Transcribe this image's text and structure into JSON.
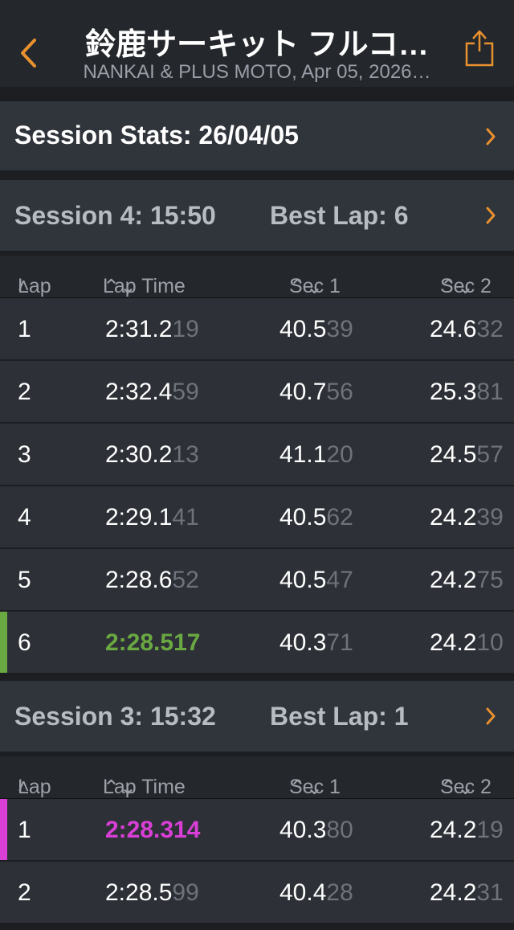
{
  "nav": {
    "title": "鈴鹿サーキット フルコ…",
    "subtitle": "NANKAI & PLUS MOTO, Apr 05, 2026…"
  },
  "stats_row": {
    "label": "Session Stats: 26/04/05"
  },
  "colors": {
    "accent": "#e8912e",
    "best_green": "#6aa842",
    "best_purple": "#d93fd6",
    "bg": "#1c1e22",
    "row": "#2d3036"
  },
  "table_header": {
    "lap": "Lap",
    "lap_time": "Lap Time",
    "sec1": "Sec 1",
    "sec2": "Sec 2",
    "lap_sort_icon": "chevron-up-icon",
    "sort_icon": "sort-updown-icon"
  },
  "sessions": [
    {
      "label": "Session 4:  15:50",
      "best": "Best Lap: 6",
      "laps": [
        {
          "lap": "1",
          "time_a": "2:31.2",
          "time_b": "19",
          "s1_a": "40.5",
          "s1_b": "39",
          "s2_a": "24.6",
          "s2_b": "32"
        },
        {
          "lap": "2",
          "time_a": "2:32.4",
          "time_b": "59",
          "s1_a": "40.7",
          "s1_b": "56",
          "s2_a": "25.3",
          "s2_b": "81"
        },
        {
          "lap": "3",
          "time_a": "2:30.2",
          "time_b": "13",
          "s1_a": "41.1",
          "s1_b": "20",
          "s2_a": "24.5",
          "s2_b": "57"
        },
        {
          "lap": "4",
          "time_a": "2:29.1",
          "time_b": "41",
          "s1_a": "40.5",
          "s1_b": "62",
          "s2_a": "24.2",
          "s2_b": "39"
        },
        {
          "lap": "5",
          "time_a": "2:28.6",
          "time_b": "52",
          "s1_a": "40.5",
          "s1_b": "47",
          "s2_a": "24.2",
          "s2_b": "75"
        },
        {
          "lap": "6",
          "time_a": "2:28.517",
          "time_b": "",
          "s1_a": "40.3",
          "s1_b": "71",
          "s2_a": "24.2",
          "s2_b": "10"
        }
      ]
    },
    {
      "label": "Session 3:  15:32",
      "best": "Best Lap: 1",
      "laps": [
        {
          "lap": "1",
          "time_a": "2:28.314",
          "time_b": "",
          "s1_a": "40.3",
          "s1_b": "80",
          "s2_a": "24.2",
          "s2_b": "19"
        },
        {
          "lap": "2",
          "time_a": "2:28.5",
          "time_b": "99",
          "s1_a": "40.4",
          "s1_b": "28",
          "s2_a": "24.2",
          "s2_b": "31"
        }
      ]
    }
  ]
}
